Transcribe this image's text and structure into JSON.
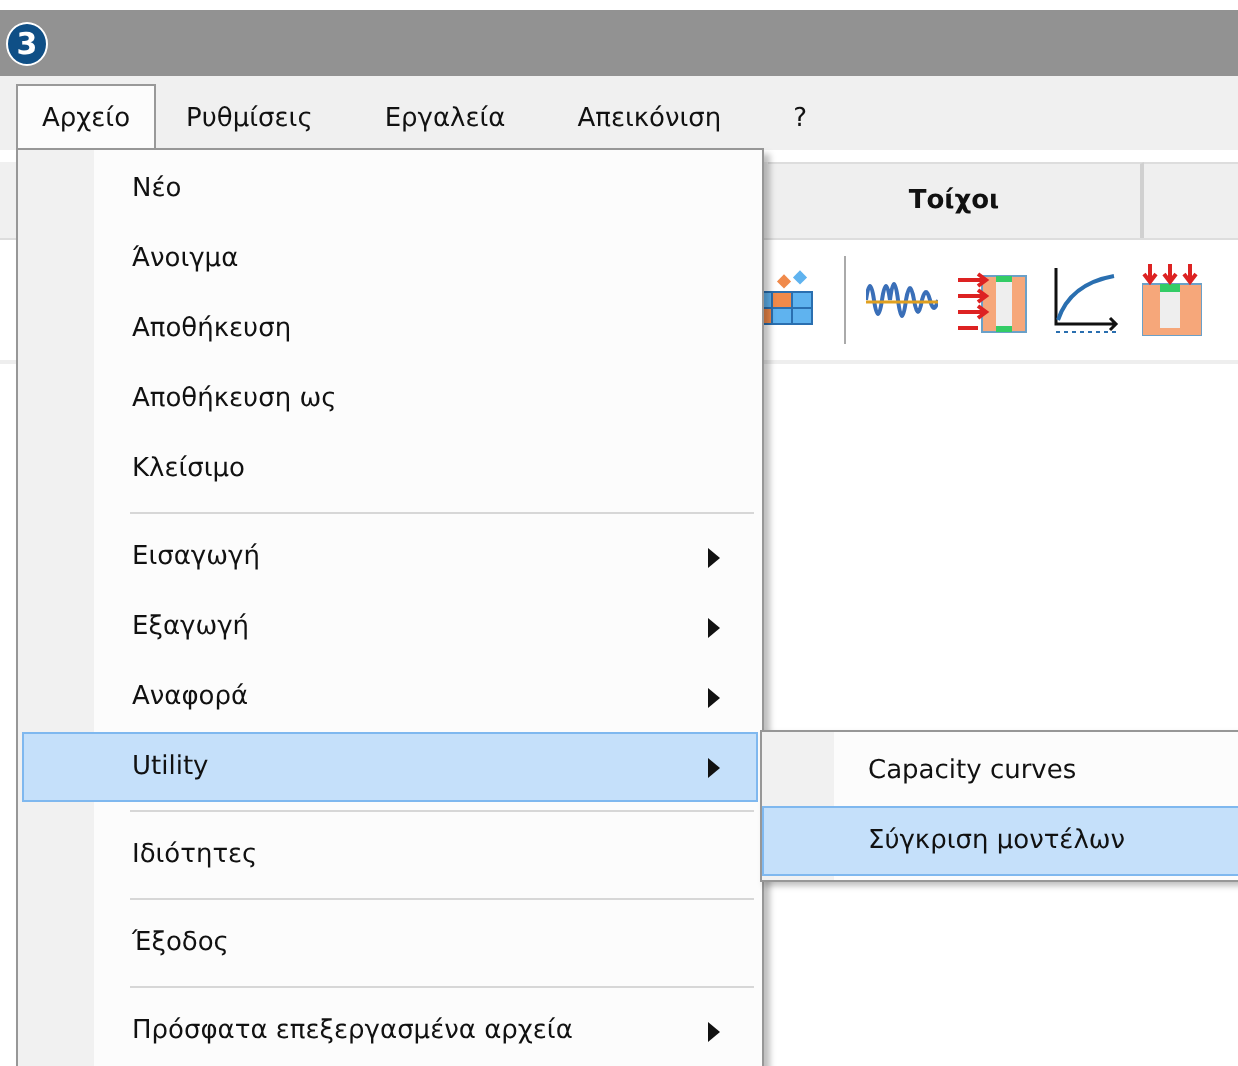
{
  "title_bar": {
    "app_icon": "3"
  },
  "menu_bar": [
    {
      "label": "Αρχείο",
      "selected": true
    },
    {
      "label": "Ρυθμίσεις",
      "selected": false
    },
    {
      "label": "Εργαλεία",
      "selected": false
    },
    {
      "label": "Απεικόνιση",
      "selected": false
    },
    {
      "label": "?",
      "selected": false
    }
  ],
  "tabs": [
    {
      "label": "Τοίχοι",
      "selected": false
    }
  ],
  "file_menu": [
    {
      "kind": "item",
      "label": "Νέο",
      "submenu": false,
      "selected": false
    },
    {
      "kind": "item",
      "label": "Άνοιγμα",
      "submenu": false,
      "selected": false
    },
    {
      "kind": "item",
      "label": "Αποθήκευση",
      "submenu": false,
      "selected": false
    },
    {
      "kind": "item",
      "label": "Αποθήκευση ως",
      "submenu": false,
      "selected": false
    },
    {
      "kind": "item",
      "label": "Κλείσιμο",
      "submenu": false,
      "selected": false
    },
    {
      "kind": "separator"
    },
    {
      "kind": "item",
      "label": "Εισαγωγή",
      "submenu": true,
      "selected": false
    },
    {
      "kind": "item",
      "label": "Εξαγωγή",
      "submenu": true,
      "selected": false
    },
    {
      "kind": "item",
      "label": "Αναφορά",
      "submenu": true,
      "selected": false
    },
    {
      "kind": "item",
      "label": "Utility",
      "submenu": true,
      "selected": true
    },
    {
      "kind": "separator"
    },
    {
      "kind": "item",
      "label": "Ιδιότητες",
      "submenu": false,
      "selected": false
    },
    {
      "kind": "separator"
    },
    {
      "kind": "item",
      "label": "Έξοδος",
      "submenu": false,
      "selected": false
    },
    {
      "kind": "separator"
    },
    {
      "kind": "item",
      "label": "Πρόσφατα επεξεργασμένα αρχεία",
      "submenu": true,
      "selected": false
    }
  ],
  "utility_submenu": [
    {
      "label": "Capacity curves",
      "selected": false
    },
    {
      "label": "Σύγκριση μοντέλων",
      "selected": true
    }
  ]
}
